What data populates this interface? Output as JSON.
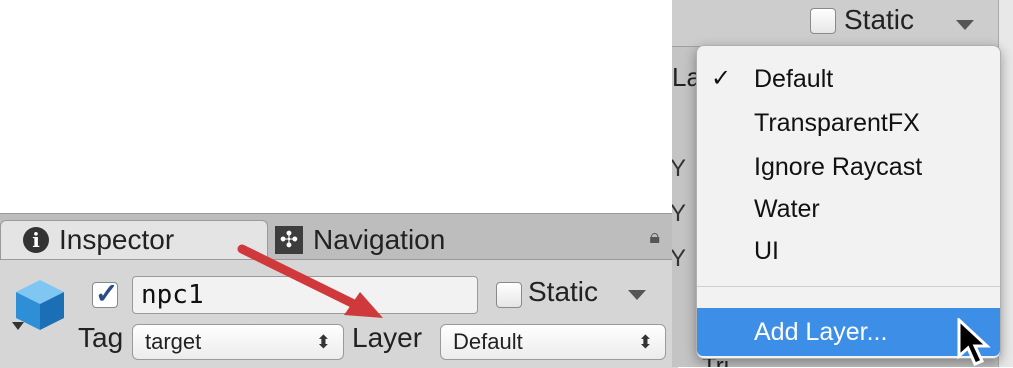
{
  "inspector": {
    "tabs": [
      {
        "label": "Inspector",
        "icon": "info-icon",
        "active": true
      },
      {
        "label": "Navigation",
        "icon": "navigation-icon",
        "active": false
      }
    ],
    "object_active": true,
    "object_name": "npc1",
    "static_label": "Static",
    "static_checked": false,
    "tag_label": "Tag",
    "tag_value": "target",
    "layer_label": "Layer",
    "layer_value": "Default",
    "lock_icon": "lock-icon",
    "object_icon": "cube-icon"
  },
  "right": {
    "static_label": "Static",
    "partial_label": "La",
    "bottom_partial": "Tri",
    "layer_menu": {
      "items": [
        {
          "label": "Default",
          "checked": true
        },
        {
          "label": "TransparentFX",
          "checked": false
        },
        {
          "label": "Ignore Raycast",
          "checked": false
        },
        {
          "label": "Water",
          "checked": false
        },
        {
          "label": "UI",
          "checked": false
        }
      ],
      "add_layer": "Add Layer..."
    }
  },
  "colors": {
    "annotation_arrow": "#d0393b",
    "menu_highlight": "#3d8ee6",
    "checkbox_mark": "#2b4c85"
  }
}
